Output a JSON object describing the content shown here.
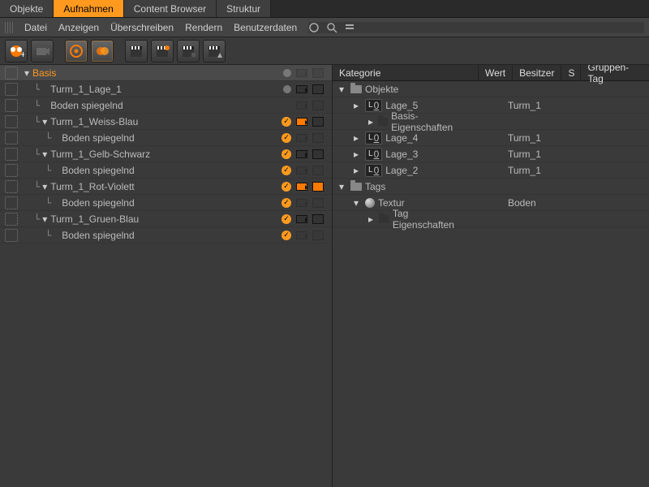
{
  "tabs": [
    "Objekte",
    "Aufnahmen",
    "Content Browser",
    "Struktur"
  ],
  "active_tab": 1,
  "menu": [
    "Datei",
    "Anzeigen",
    "Überschreiben",
    "Rendern",
    "Benutzerdaten"
  ],
  "toolbar": {
    "tools": [
      "take-new",
      "take-camera",
      "take-target",
      "take-overlap",
      "clap-1",
      "clap-2",
      "clap-3",
      "clap-4"
    ]
  },
  "colors": {
    "accent": "#ff9a1f"
  },
  "tree": [
    {
      "label": "Basis",
      "depth": 0,
      "expander": "▾",
      "orange": true,
      "selected": true,
      "status": "dot"
    },
    {
      "label": "Turm_1_Lage_1",
      "depth": 1,
      "expander": "",
      "status": "dot",
      "extras": [
        "cam",
        "clap"
      ]
    },
    {
      "label": "Boden spiegelnd",
      "depth": 1,
      "expander": "",
      "status": "none"
    },
    {
      "label": "Turm_1_Weiss-Blau",
      "depth": 1,
      "expander": "▾",
      "status": "check",
      "extras": [
        "cam-orange",
        "clap"
      ]
    },
    {
      "label": "Boden spiegelnd",
      "depth": 2,
      "expander": "",
      "status": "check"
    },
    {
      "label": "Turm_1_Gelb-Schwarz",
      "depth": 1,
      "expander": "▾",
      "status": "check",
      "extras": [
        "cam",
        "clap"
      ]
    },
    {
      "label": "Boden spiegelnd",
      "depth": 2,
      "expander": "",
      "status": "check"
    },
    {
      "label": "Turm_1_Rot-Violett",
      "depth": 1,
      "expander": "▾",
      "status": "check",
      "extras": [
        "cam-orange",
        "clap-orange"
      ]
    },
    {
      "label": "Boden spiegelnd",
      "depth": 2,
      "expander": "",
      "status": "check"
    },
    {
      "label": "Turm_1_Gruen-Blau",
      "depth": 1,
      "expander": "▾",
      "status": "check",
      "extras": [
        "cam",
        "clap"
      ]
    },
    {
      "label": "Boden spiegelnd",
      "depth": 2,
      "expander": "",
      "status": "check"
    }
  ],
  "right": {
    "headers": {
      "kategorie": "Kategorie",
      "wert": "Wert",
      "besitzer": "Besitzer",
      "s": "S",
      "gruppe": "Gruppen-Tag"
    },
    "rows": [
      {
        "type": "group",
        "icon": "folder",
        "tri": "▾",
        "label": "Objekte",
        "depth": 0
      },
      {
        "type": "item",
        "icon": "lbadge",
        "tri": "▸",
        "label": "Lage_5",
        "depth": 1,
        "besitzer": "Turm_1"
      },
      {
        "type": "sub",
        "icon": "folder-dark",
        "tri": "▸",
        "label": "Basis-Eigenschaften",
        "depth": 2
      },
      {
        "type": "item",
        "icon": "lbadge",
        "tri": "▸",
        "label": "Lage_4",
        "depth": 1,
        "besitzer": "Turm_1"
      },
      {
        "type": "item",
        "icon": "lbadge",
        "tri": "▸",
        "label": "Lage_3",
        "depth": 1,
        "besitzer": "Turm_1"
      },
      {
        "type": "item",
        "icon": "lbadge",
        "tri": "▸",
        "label": "Lage_2",
        "depth": 1,
        "besitzer": "Turm_1"
      },
      {
        "type": "group",
        "icon": "folder",
        "tri": "▾",
        "label": "Tags",
        "depth": 0
      },
      {
        "type": "item",
        "icon": "sphere",
        "tri": "▾",
        "label": "Textur",
        "depth": 1,
        "besitzer": "Boden"
      },
      {
        "type": "sub",
        "icon": "folder-dark",
        "tri": "▸",
        "label": "Tag Eigenschaften",
        "depth": 2
      }
    ]
  }
}
